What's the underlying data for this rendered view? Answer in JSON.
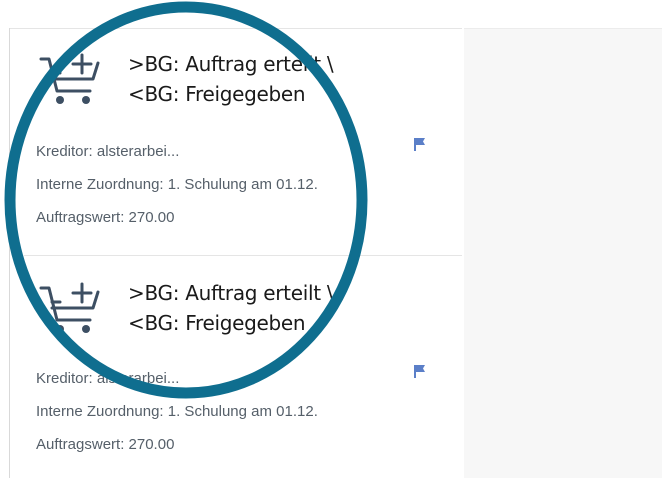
{
  "colors": {
    "accent_flag": "#5b7fc8",
    "annotation_ring": "#0f6e8f",
    "icon": "#3d4f63",
    "detail_background": "#f7f7f7"
  },
  "items": [
    {
      "icon": "add-to-cart-icon",
      "title_line1": ">BG: Auftrag erteilt \\",
      "title_line2": "<BG: Freigegeben",
      "kreditor": "Kreditor: alsterarbei...",
      "zuordnung": "Interne Zuordnung: 1. Schulung am 01.12.",
      "auftragswert": "Auftragswert: 270.00",
      "status_icon": "flag-icon"
    },
    {
      "icon": "add-to-cart-icon",
      "title_line1": ">BG: Auftrag erteilt \\",
      "title_line2": "<BG: Freigegeben",
      "kreditor": "Kreditor: alsterarbei...",
      "zuordnung": "Interne Zuordnung: 1. Schulung am 01.12.",
      "auftragswert": "Auftragswert: 270.00",
      "status_icon": "flag-icon"
    }
  ]
}
